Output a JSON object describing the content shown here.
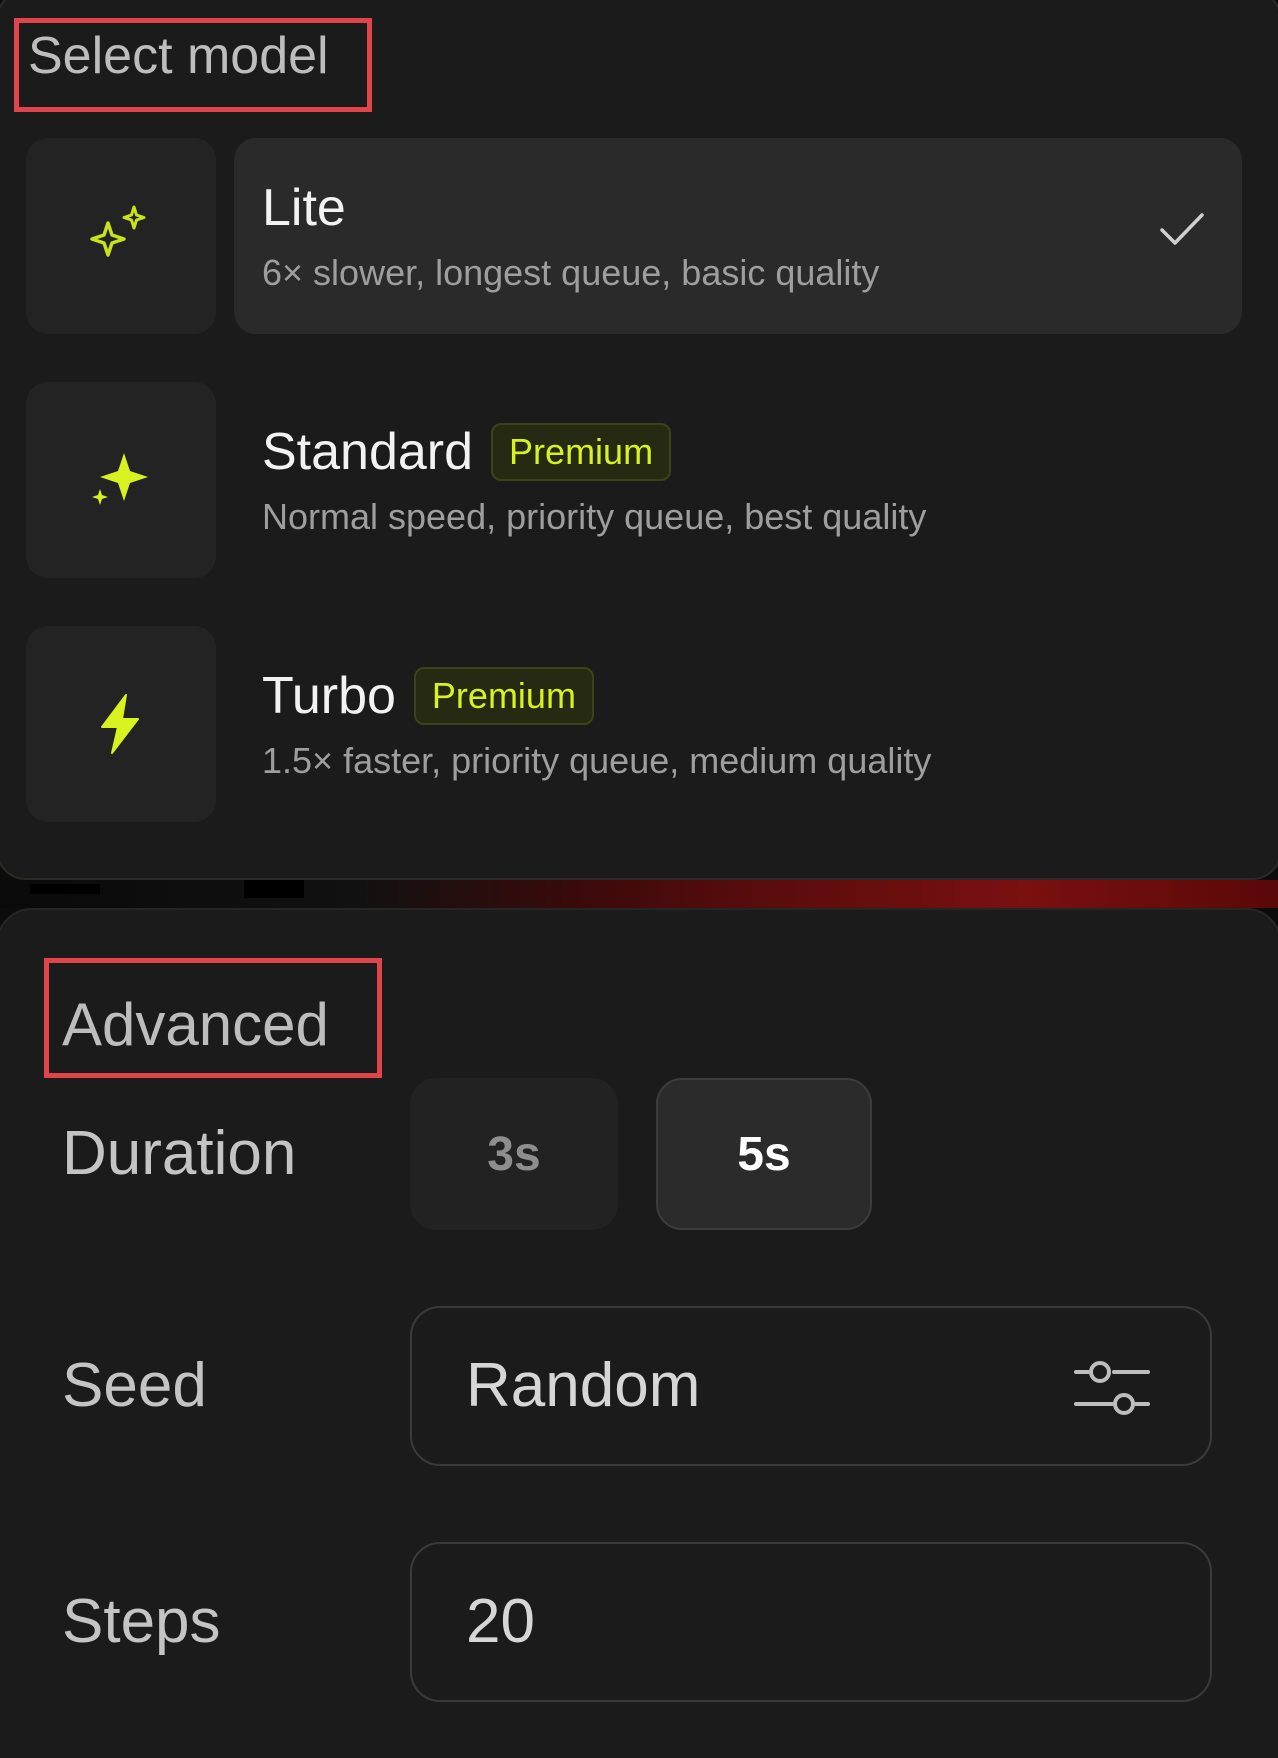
{
  "select_model": {
    "title": "Select model",
    "models": [
      {
        "name": "Lite",
        "description": "6× slower, longest queue, basic quality",
        "badge": "",
        "icon": "sparkle-outline-icon",
        "selected": true
      },
      {
        "name": "Standard",
        "description": "Normal speed, priority queue, best quality",
        "badge": "Premium",
        "icon": "sparkles-icon",
        "selected": false
      },
      {
        "name": "Turbo",
        "description": "1.5× faster, priority queue, medium quality",
        "badge": "Premium",
        "icon": "lightning-bolt-icon",
        "selected": false
      }
    ]
  },
  "advanced": {
    "title": "Advanced",
    "duration": {
      "label": "Duration",
      "options": [
        "3s",
        "5s"
      ],
      "selected": "5s"
    },
    "seed": {
      "label": "Seed",
      "value": "Random",
      "icon": "sliders-icon"
    },
    "steps": {
      "label": "Steps",
      "value": "20"
    }
  },
  "colors": {
    "accent": "#d7f21e",
    "annotation_box": "#e0454b",
    "panel_bg": "#1b1b1b"
  }
}
